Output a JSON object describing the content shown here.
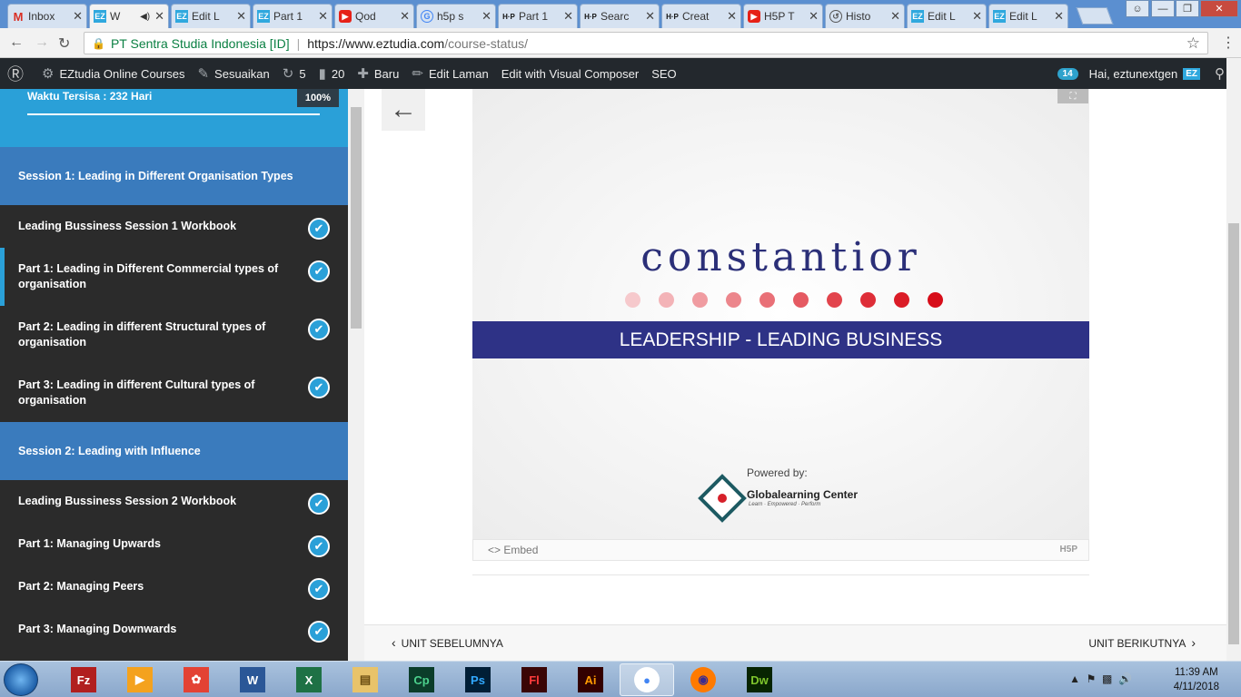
{
  "tabs": [
    {
      "label": "Inbox",
      "icon": "gmail-icon",
      "fav": "M",
      "fav_class": "fav-gm",
      "active": false
    },
    {
      "label": "W",
      "icon": "ez-icon",
      "fav": "EZ",
      "fav_class": "fav-ez",
      "active": true,
      "audio": "◀)"
    },
    {
      "label": "Edit L",
      "icon": "ez-icon",
      "fav": "EZ",
      "fav_class": "fav-ez",
      "active": false
    },
    {
      "label": "Part 1",
      "icon": "ez-icon",
      "fav": "EZ",
      "fav_class": "fav-ez",
      "active": false
    },
    {
      "label": "Qod",
      "icon": "youtube-icon",
      "fav": "▶",
      "fav_class": "fav-yt",
      "active": false
    },
    {
      "label": "h5p s",
      "icon": "google-icon",
      "fav": "G",
      "fav_class": "fav-g",
      "active": false
    },
    {
      "label": "Part 1",
      "icon": "h5p-icon",
      "fav": "H·P",
      "fav_class": "fav-h5p",
      "active": false
    },
    {
      "label": "Searc",
      "icon": "h5p-icon",
      "fav": "H·P",
      "fav_class": "fav-h5p",
      "active": false
    },
    {
      "label": "Creat",
      "icon": "h5p-icon",
      "fav": "H·P",
      "fav_class": "fav-h5p",
      "active": false
    },
    {
      "label": "H5P T",
      "icon": "youtube-icon",
      "fav": "▶",
      "fav_class": "fav-yt",
      "active": false
    },
    {
      "label": "Histo",
      "icon": "history-icon",
      "fav": "↺",
      "fav_class": "fav-hist",
      "active": false
    },
    {
      "label": "Edit L",
      "icon": "ez-icon",
      "fav": "EZ",
      "fav_class": "fav-ez",
      "active": false
    },
    {
      "label": "Edit L",
      "icon": "ez-icon",
      "fav": "EZ",
      "fav_class": "fav-ez",
      "active": false
    }
  ],
  "address": {
    "site_name": "PT Sentra Studia Indonesia [ID]",
    "url_host": "https://www.eztudia.com",
    "url_path": "/course-status/"
  },
  "adminbar": {
    "site": "EZtudia Online Courses",
    "customize": "Sesuaikan",
    "updates": "5",
    "comments": "20",
    "new": "Baru",
    "edit_page": "Edit Laman",
    "visual_composer": "Edit with Visual Composer",
    "seo": "SEO",
    "notif_count": "14",
    "greeting": "Hai, eztunextgen",
    "avatar": "EZ"
  },
  "sidebar": {
    "time_remaining": "Waktu Tersisa : 232 Hari",
    "progress": "100%",
    "progress_fraction": 1.0,
    "sessions": [
      {
        "title": "Session 1: Leading in Different Organisation Types"
      },
      {
        "title": "Session 2: Leading with Influence"
      }
    ],
    "units": [
      {
        "title": "Leading Bussiness Session 1 Workbook",
        "active": false
      },
      {
        "title": "Part 1: Leading in Different Commercial types of organisation",
        "active": true
      },
      {
        "title": "Part 2: Leading in different Structural types of organisation",
        "active": false
      },
      {
        "title": "Part 3: Leading in different Cultural types of organisation",
        "active": false
      },
      {
        "title": "Leading Bussiness Session 2 Workbook",
        "active": false
      },
      {
        "title": "Part 1: Managing Upwards",
        "active": false
      },
      {
        "title": "Part 2: Managing Peers",
        "active": false
      },
      {
        "title": "Part 3: Managing Downwards",
        "active": false
      }
    ]
  },
  "slide": {
    "logo": "constantior",
    "banner": "LEADERSHIP - LEADING BUSINESS",
    "powered_by": "Powered by:",
    "org_name": "Globalearning Center",
    "org_tagline": "Learn · Empowered · Perform",
    "dot_colors": [
      "#f6c9cc",
      "#f3b3b7",
      "#f09ca1",
      "#ec868c",
      "#e97077",
      "#e55a62",
      "#e2444d",
      "#de2e38",
      "#db1c27",
      "#d70d19"
    ]
  },
  "h5p": {
    "embed": "<> Embed",
    "logo": "H5P"
  },
  "unitnav": {
    "prev": "UNIT SEBELUMNYA",
    "next": "UNIT BERIKUTNYA"
  },
  "taskbar": {
    "apps": [
      {
        "name": "filezilla",
        "label": "Fz",
        "bg": "#b11f1f",
        "fg": "#fff"
      },
      {
        "name": "media-player",
        "label": "▶",
        "bg": "#f4a21e",
        "fg": "#fff"
      },
      {
        "name": "app-red",
        "label": "✿",
        "bg": "#e34234",
        "fg": "#fff"
      },
      {
        "name": "word",
        "label": "W",
        "bg": "#2b5797",
        "fg": "#fff"
      },
      {
        "name": "excel",
        "label": "X",
        "bg": "#1e7145",
        "fg": "#fff"
      },
      {
        "name": "explorer",
        "label": "▤",
        "bg": "#e8c36a",
        "fg": "#6b4e12"
      },
      {
        "name": "captivate",
        "label": "Cp",
        "bg": "#0b3d2a",
        "fg": "#4cd18d"
      },
      {
        "name": "photoshop",
        "label": "Ps",
        "bg": "#001e36",
        "fg": "#31a8ff"
      },
      {
        "name": "flash",
        "label": "Fl",
        "bg": "#3a0505",
        "fg": "#ff3b3b"
      },
      {
        "name": "illustrator",
        "label": "Ai",
        "bg": "#330000",
        "fg": "#ff9a00"
      },
      {
        "name": "chrome",
        "label": "●",
        "bg": "#ffffff",
        "fg": "#4285f4",
        "active": true
      },
      {
        "name": "firefox",
        "label": "◉",
        "bg": "#ff7a00",
        "fg": "#3b2b8f"
      },
      {
        "name": "dreamweaver",
        "label": "Dw",
        "bg": "#072401",
        "fg": "#7ec52c"
      }
    ],
    "time": "11:39 AM",
    "date": "4/11/2018"
  }
}
